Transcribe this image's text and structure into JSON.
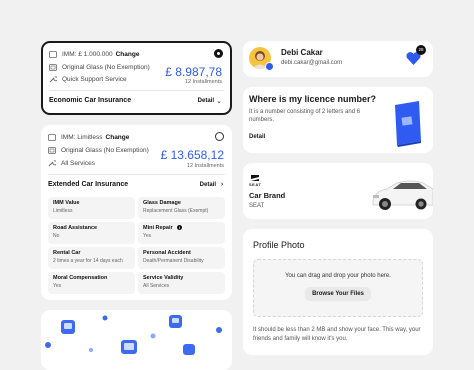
{
  "plan_a": {
    "imm_label": "IMM: £ 1.000.000",
    "change": "Change",
    "glass": "Original Glass (No Exemption)",
    "support": "Quick Support Service",
    "price": "£ 8.987,78",
    "installments": "12 Installments",
    "title": "Economic Car Insurance",
    "detail": "Detail"
  },
  "plan_b": {
    "imm_label": "IMM: Limitless",
    "change": "Change",
    "glass": "Original Glass (No Exemption)",
    "services": "All Services",
    "price": "£ 13.658,12",
    "installments": "12 Installments",
    "title": "Extended Car Insurance",
    "detail": "Detail",
    "cells": [
      {
        "k": "IMM Value",
        "v": "Limitless"
      },
      {
        "k": "Glass Damage",
        "v": "Replacement Glass (Exempt)"
      },
      {
        "k": "Road Assistance",
        "v": "No"
      },
      {
        "k": "Mini Repair",
        "v": "Yes"
      },
      {
        "k": "Rental Car",
        "v": "2 times a year for 14 days each"
      },
      {
        "k": "Personal Accident",
        "v": "Death/Permanent Disability"
      },
      {
        "k": "Moral Compensation",
        "v": "Yes"
      },
      {
        "k": "Service Validity",
        "v": "All Services"
      }
    ]
  },
  "profile": {
    "name": "Debi Cakar",
    "email": "debi.cakar@gmail.com",
    "badge_count": "28"
  },
  "licence": {
    "title": "Where is my licence number?",
    "desc": "It is a number consisting of 2 letters and 6 numbers.",
    "detail": "Detail"
  },
  "car": {
    "logo_text": "SEAT",
    "label": "Car Brand",
    "value": "SEAT"
  },
  "photo": {
    "title": "Profile Photo",
    "drop_text": "You can drag and drop your photo here.",
    "button": "Browse Your Files",
    "hint": "It should be less than 2 MB and show your face. This way, your friends and family will know it's you."
  },
  "colors": {
    "accent": "#2f5bf0",
    "dark": "#1a1a1a"
  }
}
